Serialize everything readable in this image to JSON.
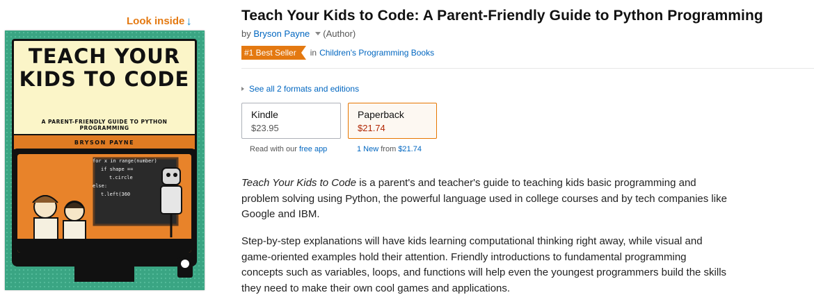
{
  "look_inside": {
    "label": "Look inside",
    "arrow": "↓",
    "icon": "down-arrow-icon",
    "color": "#e47911"
  },
  "cover": {
    "title": "TEACH YOUR KIDS TO CODE",
    "subtitle": "A PARENT-FRIENDLY GUIDE TO PYTHON PROGRAMMING",
    "author": "BRYSON PAYNE",
    "code_lines": [
      "for x in range(number)",
      "if shape ==",
      "t.circle",
      "else:",
      "t.left(360"
    ]
  },
  "product": {
    "title": "Teach Your Kids to Code: A Parent-Friendly Guide to Python Programming",
    "by_label": "by",
    "author": "Bryson Payne",
    "author_role": "(Author)",
    "badge": "#1 Best Seller",
    "badge_color": "#e47911",
    "in_label": "in",
    "category": "Children's Programming Books",
    "formats_link": "See all 2 formats and editions"
  },
  "formats": [
    {
      "name": "Kindle",
      "price": "$23.95",
      "selected": false
    },
    {
      "name": "Paperback",
      "price": "$21.74",
      "selected": true
    }
  ],
  "kindle_sub": {
    "prefix": "Read with our",
    "link": "free app"
  },
  "paperback_sub": {
    "link": "1 New",
    "suffix": "from",
    "price": "$21.74"
  },
  "description": {
    "p1_em": "Teach Your Kids to Code",
    "p1_rest": " is a parent's and teacher's guide to teaching kids basic programming and problem solving using Python, the powerful language used in college courses and by tech companies like Google and IBM.",
    "p2": "Step-by-step explanations will have kids learning computational thinking right away, while visual and game-oriented examples hold their attention. Friendly introductions to fundamental programming concepts such as variables, loops, and functions will help even the youngest programmers build the skills they need to make their own cool games and applications."
  },
  "colors": {
    "link": "#0066c0",
    "price": "#b12704",
    "selected_border": "#e77600"
  }
}
